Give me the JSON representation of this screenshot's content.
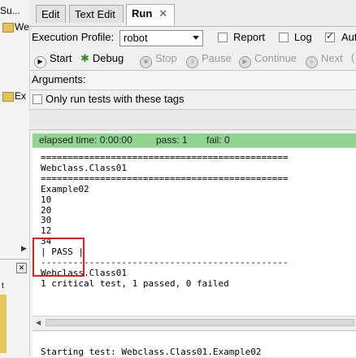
{
  "left_panel": {
    "item1": "Su...",
    "item2": "We",
    "item3": "Ex",
    "item4": "t"
  },
  "tabs": [
    {
      "label": "Edit"
    },
    {
      "label": "Text Edit"
    },
    {
      "label": "Run",
      "close": "✕"
    }
  ],
  "profile": {
    "label": "Execution Profile:",
    "value": "robot",
    "report_label": "Report",
    "log_label": "Log",
    "aut_label": "Aut"
  },
  "toolbar": {
    "start": "Start",
    "debug": "Debug",
    "stop": "Stop",
    "pause": "Pause",
    "continue": "Continue",
    "next": "Next"
  },
  "arguments_label": "Arguments:",
  "only_tags_label": "Only run tests with these tags",
  "status": {
    "elapsed": "elapsed time: 0:00:00",
    "pass": "pass: 1",
    "fail": "fail: 0",
    "color": "#8fd48f"
  },
  "output": {
    "text": "==============================================\nWebclass.Class01\n==============================================\nExample02\n10\n20\n30\n12\n34\n| PASS |\n----------------------------------------------\nWebclass.Class01\n1 critical test, 1 passed, 0 failed"
  },
  "output2": {
    "text": "Starting test: Webclass.Class01.Example02"
  },
  "highlight_color": "#e02020"
}
